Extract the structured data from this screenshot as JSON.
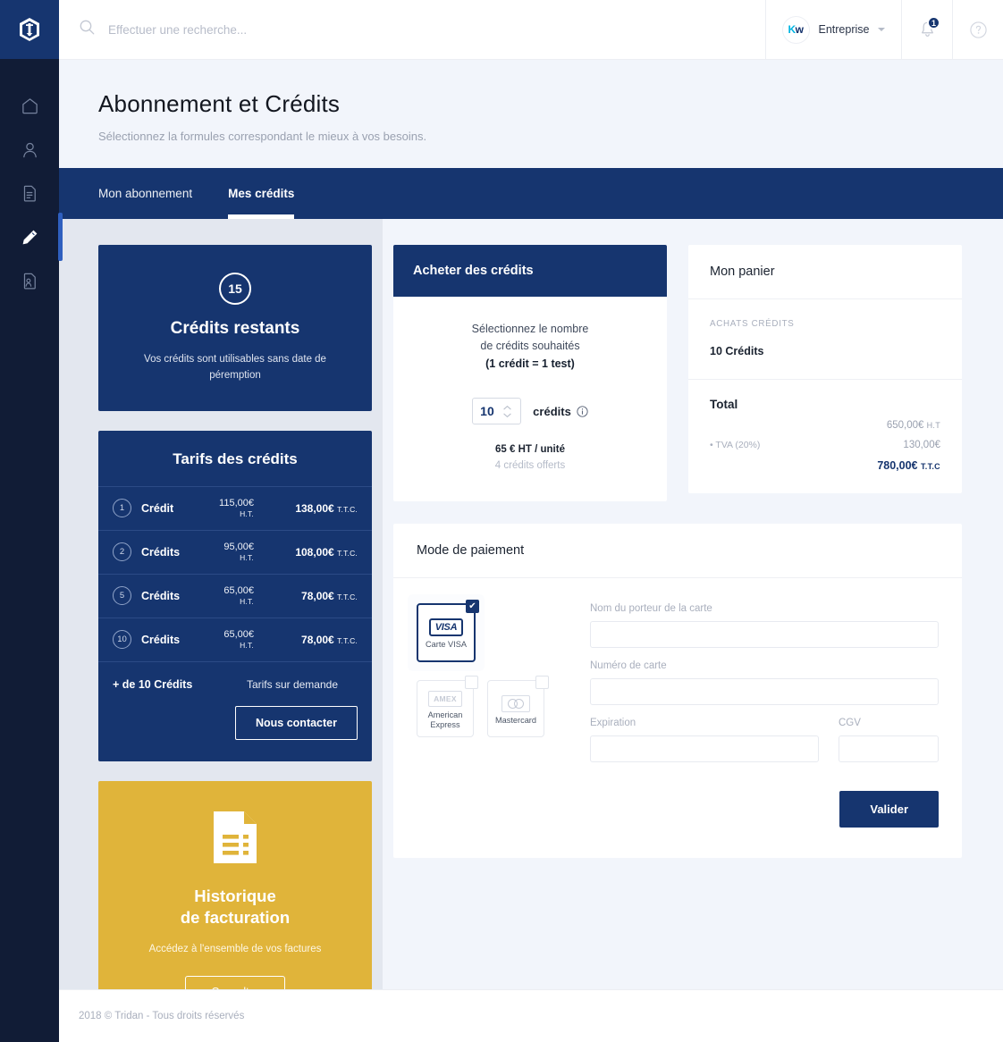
{
  "brand": {
    "logo_icon": "tridan-shield-logo"
  },
  "sidebar": {
    "items": [
      {
        "icon": "home-icon",
        "name": "home",
        "active": false
      },
      {
        "icon": "user-icon",
        "name": "profile",
        "active": false
      },
      {
        "icon": "document-icon",
        "name": "documents",
        "active": false
      },
      {
        "icon": "pencil-icon",
        "name": "edit",
        "active": true
      },
      {
        "icon": "document-user-icon",
        "name": "candidates",
        "active": false
      }
    ]
  },
  "topbar": {
    "search_placeholder": "Effectuer une recherche...",
    "search_value": "",
    "search_icon": "search-icon",
    "account_name": "Entreprise",
    "account_avatar_initials_1": "K",
    "account_avatar_initials_2": "w",
    "notification_icon": "bell-icon",
    "notification_count": "1",
    "help_icon": "question-circle-icon"
  },
  "page": {
    "title": "Abonnement et Crédits",
    "subtitle": "Sélectionnez la formules correspondant le mieux à vos besoins."
  },
  "tabs": [
    {
      "label": "Mon abonnement",
      "active": false
    },
    {
      "label": "Mes crédits",
      "active": true
    }
  ],
  "credits_card": {
    "count": "15",
    "label": "Crédits restants",
    "note": "Vos crédits sont utilisables sans date de péremption"
  },
  "tarifs_card": {
    "title": "Tarifs des crédits",
    "rows": [
      {
        "qty": "1",
        "unit": "Crédit",
        "ht": "115,00€",
        "ht_suffix": "H.T.",
        "ttc": "138,00€",
        "ttc_suffix": "T.T.C."
      },
      {
        "qty": "2",
        "unit": "Crédits",
        "ht": "95,00€",
        "ht_suffix": "H.T.",
        "ttc": "108,00€",
        "ttc_suffix": "T.T.C."
      },
      {
        "qty": "5",
        "unit": "Crédits",
        "ht": "65,00€",
        "ht_suffix": "H.T.",
        "ttc": "78,00€",
        "ttc_suffix": "T.T.C."
      },
      {
        "qty": "10",
        "unit": "Crédits",
        "ht": "65,00€",
        "ht_suffix": "H.T.",
        "ttc": "78,00€",
        "ttc_suffix": "T.T.C."
      }
    ],
    "more_label": "+ de 10 Crédits",
    "more_value": "Tarifs sur demande",
    "contact_button": "Nous contacter"
  },
  "billing_card": {
    "icon": "invoice-document-icon",
    "title_line1": "Historique",
    "title_line2": "de facturation",
    "subtitle": "Accédez à l'ensemble de vos factures",
    "button": "Consulter",
    "color": "#e0b43a"
  },
  "buy_panel": {
    "header": "Acheter des crédits",
    "lead_line1": "Sélectionnez le nombre",
    "lead_line2": "de crédits souhaités",
    "lead_line3": "(1 crédit = 1 test)",
    "quantity": "10",
    "quantity_unit": "crédits",
    "info_icon": "info-circle-icon",
    "unit_price": "65 € HT / unité",
    "bonus": "4 crédits offerts"
  },
  "cart_panel": {
    "header": "Mon panier",
    "section_kicker": "ACHATS CRÉDITS",
    "item": "10 Crédits",
    "total_label": "Total",
    "lines": [
      {
        "label": "",
        "value": "650,00€",
        "suffix": "H.T"
      },
      {
        "label": "• TVA (20%)",
        "value": "130,00€",
        "suffix": ""
      },
      {
        "label": "",
        "value": "780,00€",
        "suffix": "T.T.C"
      }
    ]
  },
  "payment_panel": {
    "header": "Mode de paiement",
    "methods": [
      {
        "name": "visa",
        "label": "Carte VISA",
        "logo_text": "VISA",
        "selected": true
      },
      {
        "name": "amex",
        "label": "American Express",
        "logo_text": "AMEX",
        "selected": false
      },
      {
        "name": "mastercard",
        "label": "Mastercard",
        "logo_text": "",
        "selected": false
      }
    ],
    "fields": [
      {
        "name": "cardholder",
        "label": "Nom du porteur de la carte",
        "value": ""
      },
      {
        "name": "cardnumber",
        "label": "Numéro de carte",
        "value": ""
      },
      {
        "name": "expiration",
        "label": "Expiration",
        "value": ""
      },
      {
        "name": "cgv",
        "label": "CGV",
        "value": ""
      }
    ],
    "submit_button": "Valider"
  },
  "footer": {
    "text": "2018 © Tridan - Tous droits réservés"
  },
  "colors": {
    "navy": "#16356f",
    "rail": "#111c36",
    "gold": "#e0b43a",
    "page_bg": "#f2f5fb",
    "left_col_bg": "#e3e7ef",
    "accent_blue": "#2f5fbf"
  }
}
